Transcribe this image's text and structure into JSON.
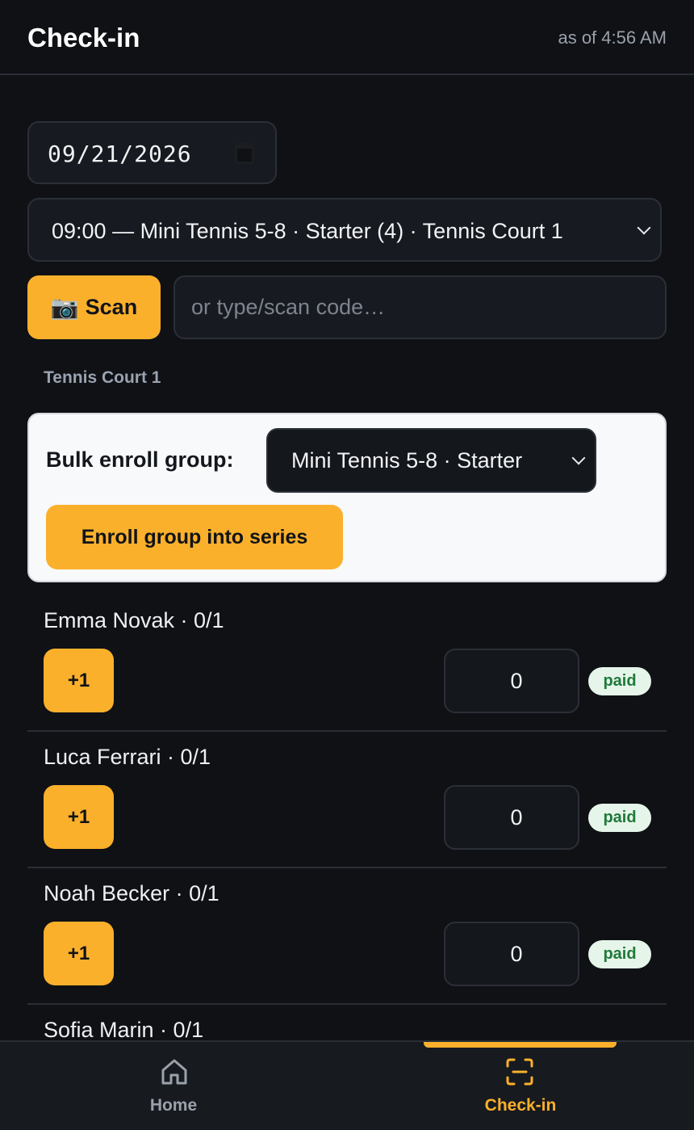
{
  "header": {
    "title": "Check-in",
    "as_of": "as of 4:56 AM"
  },
  "date": {
    "value": "09/21/2026"
  },
  "session": {
    "selected": "09:00 — Mini Tennis 5-8 · Starter (4) · Tennis Court 1"
  },
  "scan": {
    "icon": "📷",
    "label": "Scan",
    "placeholder": "or type/scan code…"
  },
  "court_label": "Tennis Court 1",
  "bulk": {
    "label": "Bulk enroll group:",
    "selected_group": "Mini Tennis 5-8 · Starter",
    "enroll_button": "Enroll group into series"
  },
  "participants": [
    {
      "name": "Emma Novak · 0/1",
      "plus": "+1",
      "count": "0",
      "status": "paid"
    },
    {
      "name": "Luca Ferrari · 0/1",
      "plus": "+1",
      "count": "0",
      "status": "paid"
    },
    {
      "name": "Noah Becker · 0/1",
      "plus": "+1",
      "count": "0",
      "status": "paid"
    },
    {
      "name": "Sofia Marin · 0/1"
    }
  ],
  "nav": {
    "home": {
      "label": "Home",
      "icon": "home-icon"
    },
    "checkin": {
      "label": "Check-in",
      "icon": "scan-icon",
      "active": true
    }
  },
  "colors": {
    "accent": "#fbb02c",
    "background": "#0f1115",
    "paid_badge_bg": "#e6f5ea",
    "paid_badge_text": "#1e7a3a"
  }
}
